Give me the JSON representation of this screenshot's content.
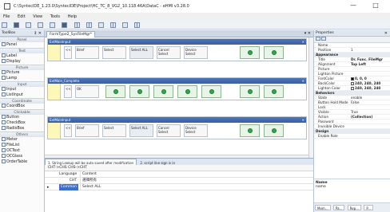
{
  "window": {
    "title": "C:\\SyntecIDE_1.23.0\\SyntecIDE\\Project\\HC_TC_8_VG2_10.118.46A\\DataC - eHMI v3.28.0",
    "controls": [
      "—",
      "□"
    ]
  },
  "menu": [
    "File",
    "Edit",
    "View",
    "Tools",
    "Help"
  ],
  "toolbox": {
    "title": "ToolBox",
    "pin": "↕ ✕",
    "groups": [
      {
        "name": "Panel",
        "items": []
      },
      {
        "name": "",
        "items": [
          "Panel"
        ]
      },
      {
        "name": "Text",
        "items": [
          "Label",
          "Display"
        ]
      },
      {
        "name": "Picture",
        "items": [
          "Picture",
          "Lamp"
        ]
      },
      {
        "name": "Input",
        "items": [
          "Input",
          "ListInput"
        ]
      },
      {
        "name": "Coordinate",
        "items": [
          "CoordBox"
        ]
      },
      {
        "name": "Clickable",
        "items": [
          "Button",
          "CheckBox",
          "RadioBox"
        ]
      },
      {
        "name": "Others",
        "items": [
          "Meter",
          "FileList",
          "OCText",
          "OCGlass",
          "OrderTable"
        ]
      }
    ]
  },
  "document": {
    "tab": "FormType2_SysFileMgr*",
    "controls": "▾ ✕",
    "pages": [
      {
        "title": "ExtMainInput",
        "cells": [
          "Brief",
          "Select",
          "Select ALL",
          "Cancel Select",
          "Device Select"
        ],
        "green_buttons": 2
      },
      {
        "title": "ExtMain_Complete",
        "cells": [
          "OK"
        ],
        "green_buttons": 7
      },
      {
        "title": "ExtMainInput",
        "cells": [
          "Brief",
          "Select",
          "Select ALL",
          "Cancel Select",
          "Device Select"
        ],
        "green_buttons": 2
      }
    ]
  },
  "language_panel": {
    "tabs": [
      "1. String Lookup will be auto saved after modification",
      "2. script line sign is in"
    ],
    "second_row": "CHT->CHS   CHS->CHT",
    "headers": [
      "Language",
      "Content"
    ],
    "rows": [
      {
        "lang": "CHT",
        "content": "選擇所有"
      },
      {
        "lang": "Common",
        "content": "Select ALL"
      }
    ]
  },
  "properties": {
    "title": "Properties",
    "categories": [
      {
        "name": "",
        "rows": [
          {
            "k": "Name",
            "v": ""
          },
          {
            "k": "Position",
            "v": "1"
          }
        ]
      },
      {
        "name": "Appearance",
        "rows": [
          {
            "k": "Title",
            "v": "Dr. Func. FileMgr"
          },
          {
            "k": "Alignment",
            "v": "Top Left"
          },
          {
            "k": "Picture",
            "v": ""
          },
          {
            "k": "Lighton Picture",
            "v": ""
          },
          {
            "k": "FontColor",
            "v": "0, 0, 0"
          },
          {
            "k": "BackColor",
            "v": "240, 240, 240"
          },
          {
            "k": "Lighton Color",
            "v": "240, 240, 240"
          }
        ]
      },
      {
        "name": "Behaviors",
        "rows": [
          {
            "k": "State",
            "v": "enable"
          },
          {
            "k": "Button Hold Mode",
            "v": "False"
          },
          {
            "k": "Lock",
            "v": ""
          },
          {
            "k": "Visible",
            "v": "True"
          },
          {
            "k": "Action",
            "v": "(Collection)"
          },
          {
            "k": "Password",
            "v": ""
          },
          {
            "k": "Invisible Device",
            "v": ""
          }
        ]
      },
      {
        "name": "Design",
        "rows": [
          {
            "k": "Enable Role",
            "v": ""
          }
        ]
      }
    ],
    "description": {
      "name": "Name",
      "text": "name"
    },
    "footer_tabs": [
      "Mem...",
      "Pa...",
      "Rep...",
      "P..."
    ],
    "colors": {
      "font": "#000000",
      "back": "#f0f0f0"
    }
  }
}
